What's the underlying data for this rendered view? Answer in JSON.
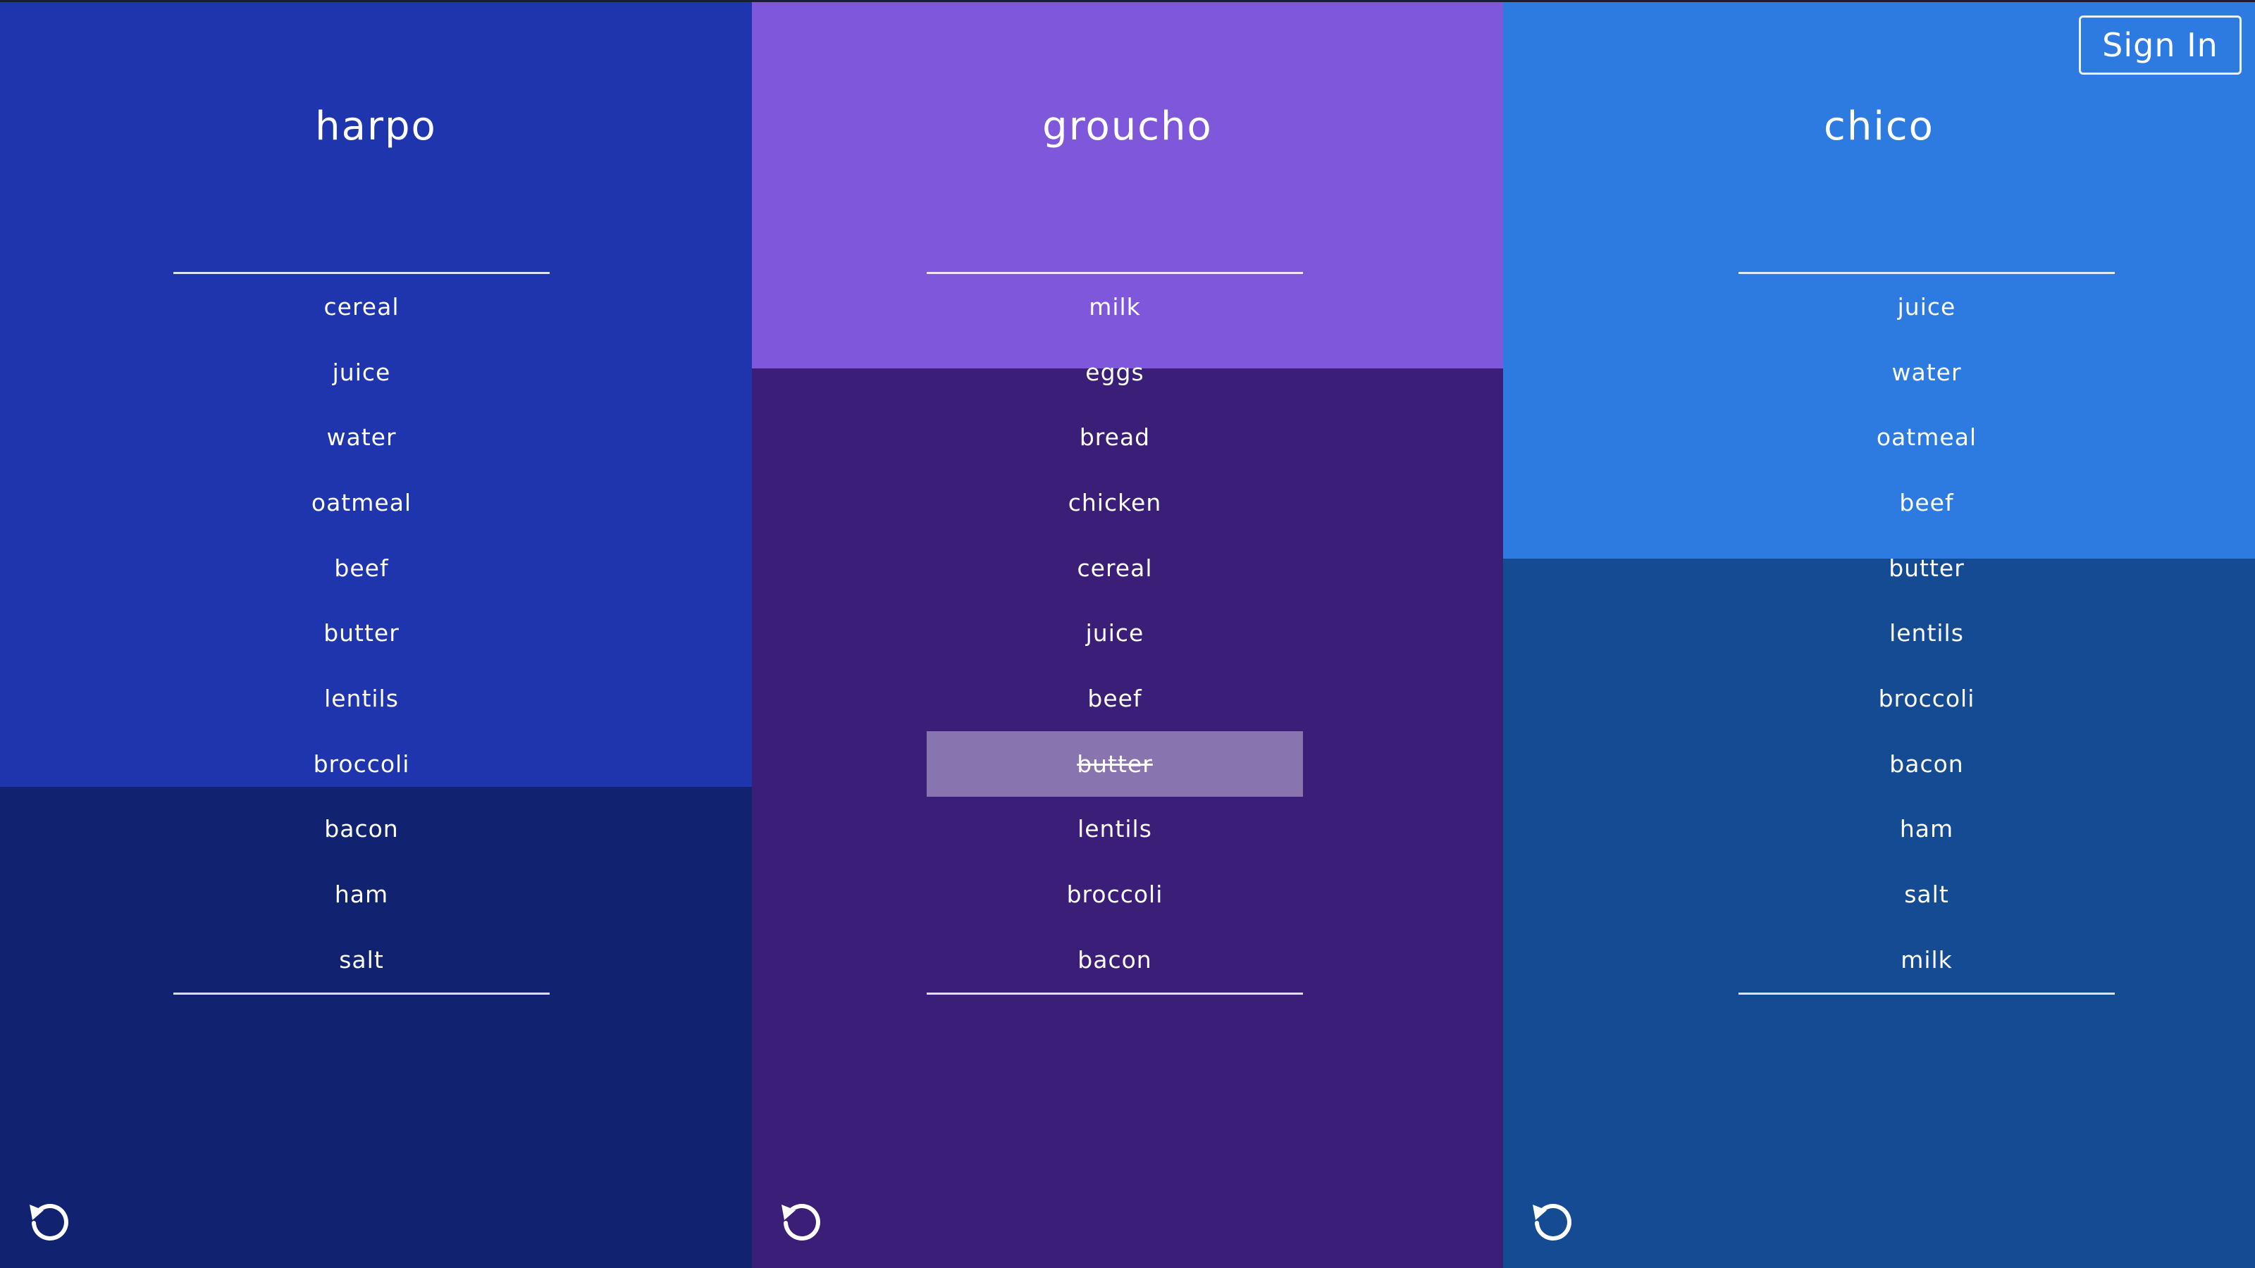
{
  "header": {
    "sign_in_label": "Sign In"
  },
  "columns": [
    {
      "title": "harpo",
      "fill_level": 0.62,
      "colors": {
        "light": "#1e35ad",
        "dark": "#102270"
      },
      "items": [
        {
          "label": "cereal",
          "done": false
        },
        {
          "label": "juice",
          "done": false
        },
        {
          "label": "water",
          "done": false
        },
        {
          "label": "oatmeal",
          "done": false
        },
        {
          "label": "beef",
          "done": false
        },
        {
          "label": "butter",
          "done": false
        },
        {
          "label": "lentils",
          "done": false
        },
        {
          "label": "broccoli",
          "done": false
        },
        {
          "label": "bacon",
          "done": false
        },
        {
          "label": "ham",
          "done": false
        },
        {
          "label": "salt",
          "done": false
        }
      ],
      "reset_icon": "reset-icon"
    },
    {
      "title": "groucho",
      "fill_level": 0.29,
      "colors": {
        "light": "#7e57da",
        "dark": "#3a1e78"
      },
      "items": [
        {
          "label": "milk",
          "done": false
        },
        {
          "label": "eggs",
          "done": false
        },
        {
          "label": "bread",
          "done": false
        },
        {
          "label": "chicken",
          "done": false
        },
        {
          "label": "cereal",
          "done": false
        },
        {
          "label": "juice",
          "done": false
        },
        {
          "label": "beef",
          "done": false
        },
        {
          "label": "butter",
          "done": true
        },
        {
          "label": "lentils",
          "done": false
        },
        {
          "label": "broccoli",
          "done": false
        },
        {
          "label": "bacon",
          "done": false
        }
      ],
      "reset_icon": "reset-icon"
    },
    {
      "title": "chico",
      "fill_level": 0.44,
      "colors": {
        "light": "#2d7be0",
        "dark": "#154b93"
      },
      "items": [
        {
          "label": "juice",
          "done": false
        },
        {
          "label": "water",
          "done": false
        },
        {
          "label": "oatmeal",
          "done": false
        },
        {
          "label": "beef",
          "done": false
        },
        {
          "label": "butter",
          "done": false
        },
        {
          "label": "lentils",
          "done": false
        },
        {
          "label": "broccoli",
          "done": false
        },
        {
          "label": "bacon",
          "done": false
        },
        {
          "label": "ham",
          "done": false
        },
        {
          "label": "salt",
          "done": false
        },
        {
          "label": "milk",
          "done": false
        }
      ],
      "reset_icon": "reset-icon"
    }
  ]
}
